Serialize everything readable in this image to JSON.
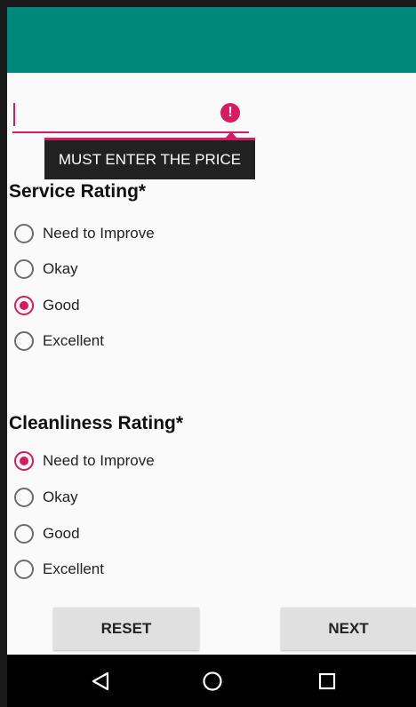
{
  "price_field": {
    "value": "",
    "error_message": "MUST ENTER THE PRICE"
  },
  "service_rating": {
    "title": "Service Rating*",
    "options": [
      "Need to Improve",
      "Okay",
      "Good",
      "Excellent"
    ],
    "selected": "Good"
  },
  "cleanliness_rating": {
    "title": "Cleanliness Rating*",
    "options": [
      "Need to Improve",
      "Okay",
      "Good",
      "Excellent"
    ],
    "selected": "Need to Improve"
  },
  "buttons": {
    "reset_label": "RESET",
    "next_label": "NEXT"
  },
  "nav": {
    "back_icon": "back-triangle-icon",
    "home_icon": "home-circle-icon",
    "recents_icon": "recents-square-icon"
  },
  "colors": {
    "app_bar": "#00897b",
    "accent": "#d81b60",
    "tooltip_bg": "#212121",
    "button_bg": "#e0e0e0",
    "nav_bar": "#000000"
  }
}
